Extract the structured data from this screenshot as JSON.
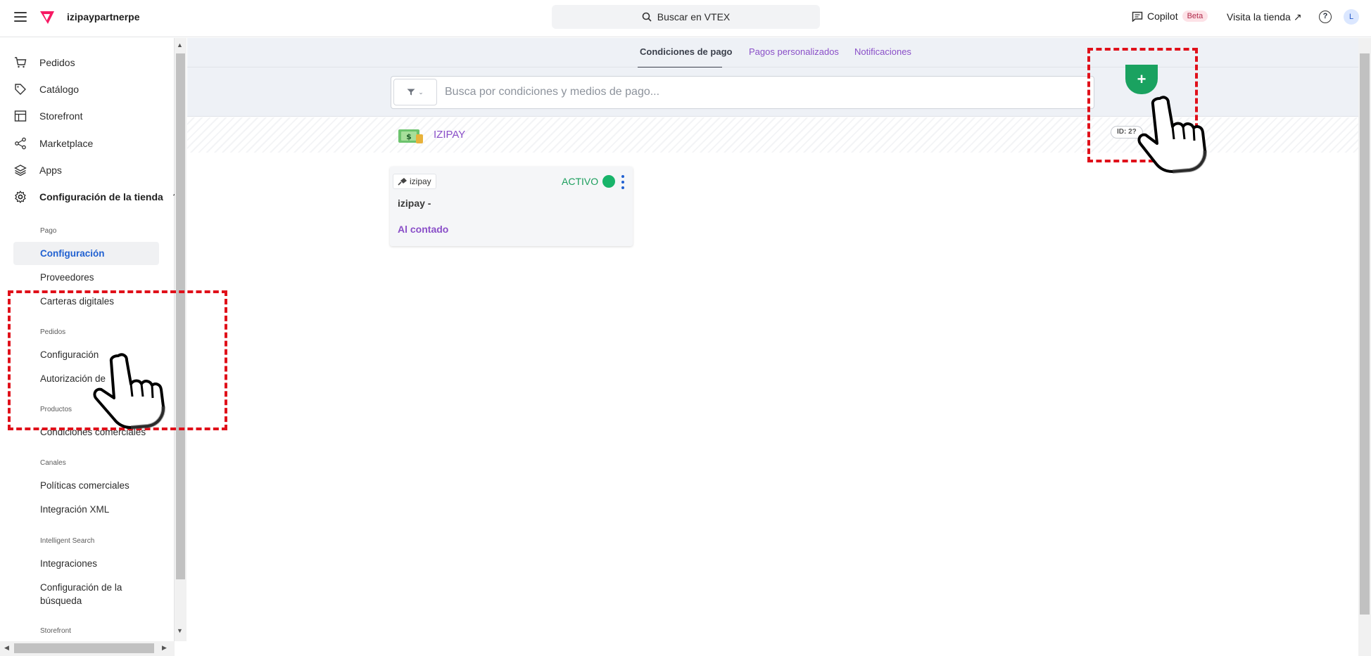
{
  "header": {
    "account_name": "izipaypartnerpe",
    "search_label": "Buscar en VTEX",
    "copilot_label": "Copilot",
    "beta_badge": "Beta",
    "visit_store_label": "Visita la tienda",
    "help_label": "?",
    "avatar_initial": "L"
  },
  "sidebar": {
    "main_items": [
      {
        "label": "Pedidos",
        "icon": "cart-icon"
      },
      {
        "label": "Catálogo",
        "icon": "tag-icon"
      },
      {
        "label": "Storefront",
        "icon": "layout-icon"
      },
      {
        "label": "Marketplace",
        "icon": "share-icon"
      },
      {
        "label": "Apps",
        "icon": "layers-icon"
      },
      {
        "label": "Configuración de la tienda",
        "icon": "gear-icon"
      }
    ],
    "sections": [
      {
        "title": "Pago",
        "items": [
          "Configuración",
          "Proveedores",
          "Carteras digitales"
        ]
      },
      {
        "title": "Pedidos",
        "items": [
          "Configuración",
          "Autorización de"
        ]
      },
      {
        "title": "Productos",
        "items": [
          "Condiciones comerciales"
        ]
      },
      {
        "title": "Canales",
        "items": [
          "Políticas comerciales",
          "Integración XML"
        ]
      },
      {
        "title": "Intelligent Search",
        "items": [
          "Integraciones",
          "Configuración de la",
          "búsqueda"
        ]
      },
      {
        "title": "Storefront",
        "items": []
      }
    ]
  },
  "tabs": [
    "Condiciones de pago",
    "Pagos personalizados",
    "Notificaciones"
  ],
  "search": {
    "placeholder": "Busca por condiciones y medios de pago..."
  },
  "group": {
    "title": "IZIPAY",
    "id_badge": "ID: 2?"
  },
  "card": {
    "provider": "izipay",
    "status": "ACTIVO",
    "title": "izipay -",
    "subtitle": "Al contado"
  },
  "add_button_label": "+",
  "colors": {
    "accent_purple": "#8a4fc8",
    "active_green": "#18b46a",
    "selection_blue": "#2161d1",
    "highlight_red": "#e0101a"
  }
}
